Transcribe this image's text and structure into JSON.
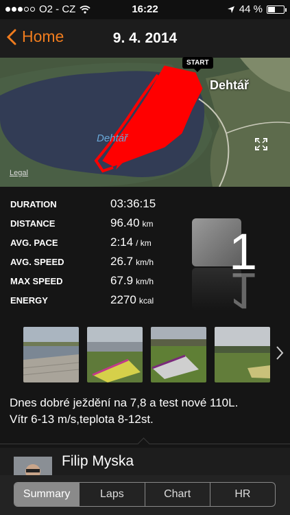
{
  "status_bar": {
    "carrier": "O2 - CZ",
    "time": "16:22",
    "battery": "44 %",
    "battery_level": 0.44,
    "signal_bars": 3,
    "icons": [
      "wifi-icon",
      "location-arrow-icon",
      "battery-icon"
    ]
  },
  "nav": {
    "back_label": "Home",
    "title": "9. 4. 2014"
  },
  "map": {
    "start_label": "START",
    "town_label": "Dehtář",
    "lake_label": "Dehtář",
    "legal_label": "Legal",
    "route_color": "#ff0000"
  },
  "stats": [
    {
      "label": "DURATION",
      "value": "03:36:15",
      "unit": ""
    },
    {
      "label": "DISTANCE",
      "value": "96.40",
      "unit": "km"
    },
    {
      "label": "AVG. PACE",
      "value": "2:14",
      "unit": "/ km"
    },
    {
      "label": "AVG. SPEED",
      "value": "26.7",
      "unit": "km/h"
    },
    {
      "label": "MAX SPEED",
      "value": "67.9",
      "unit": "km/h"
    },
    {
      "label": "ENERGY",
      "value": "2270",
      "unit": "kcal"
    }
  ],
  "achievement": {
    "number": "1"
  },
  "photos_count": 4,
  "description": {
    "line1": "Dnes dobré ježdění na 7,8 a test nové 110L.",
    "line2": "Vítr 6-13 m/s,teplota 8-12st."
  },
  "user": {
    "name": "Filip Myska"
  },
  "tabs": [
    {
      "label": "Summary",
      "active": true
    },
    {
      "label": "Laps",
      "active": false
    },
    {
      "label": "Chart",
      "active": false
    },
    {
      "label": "HR",
      "active": false
    }
  ],
  "colors": {
    "accent": "#f07c1e",
    "background": "#151515"
  }
}
